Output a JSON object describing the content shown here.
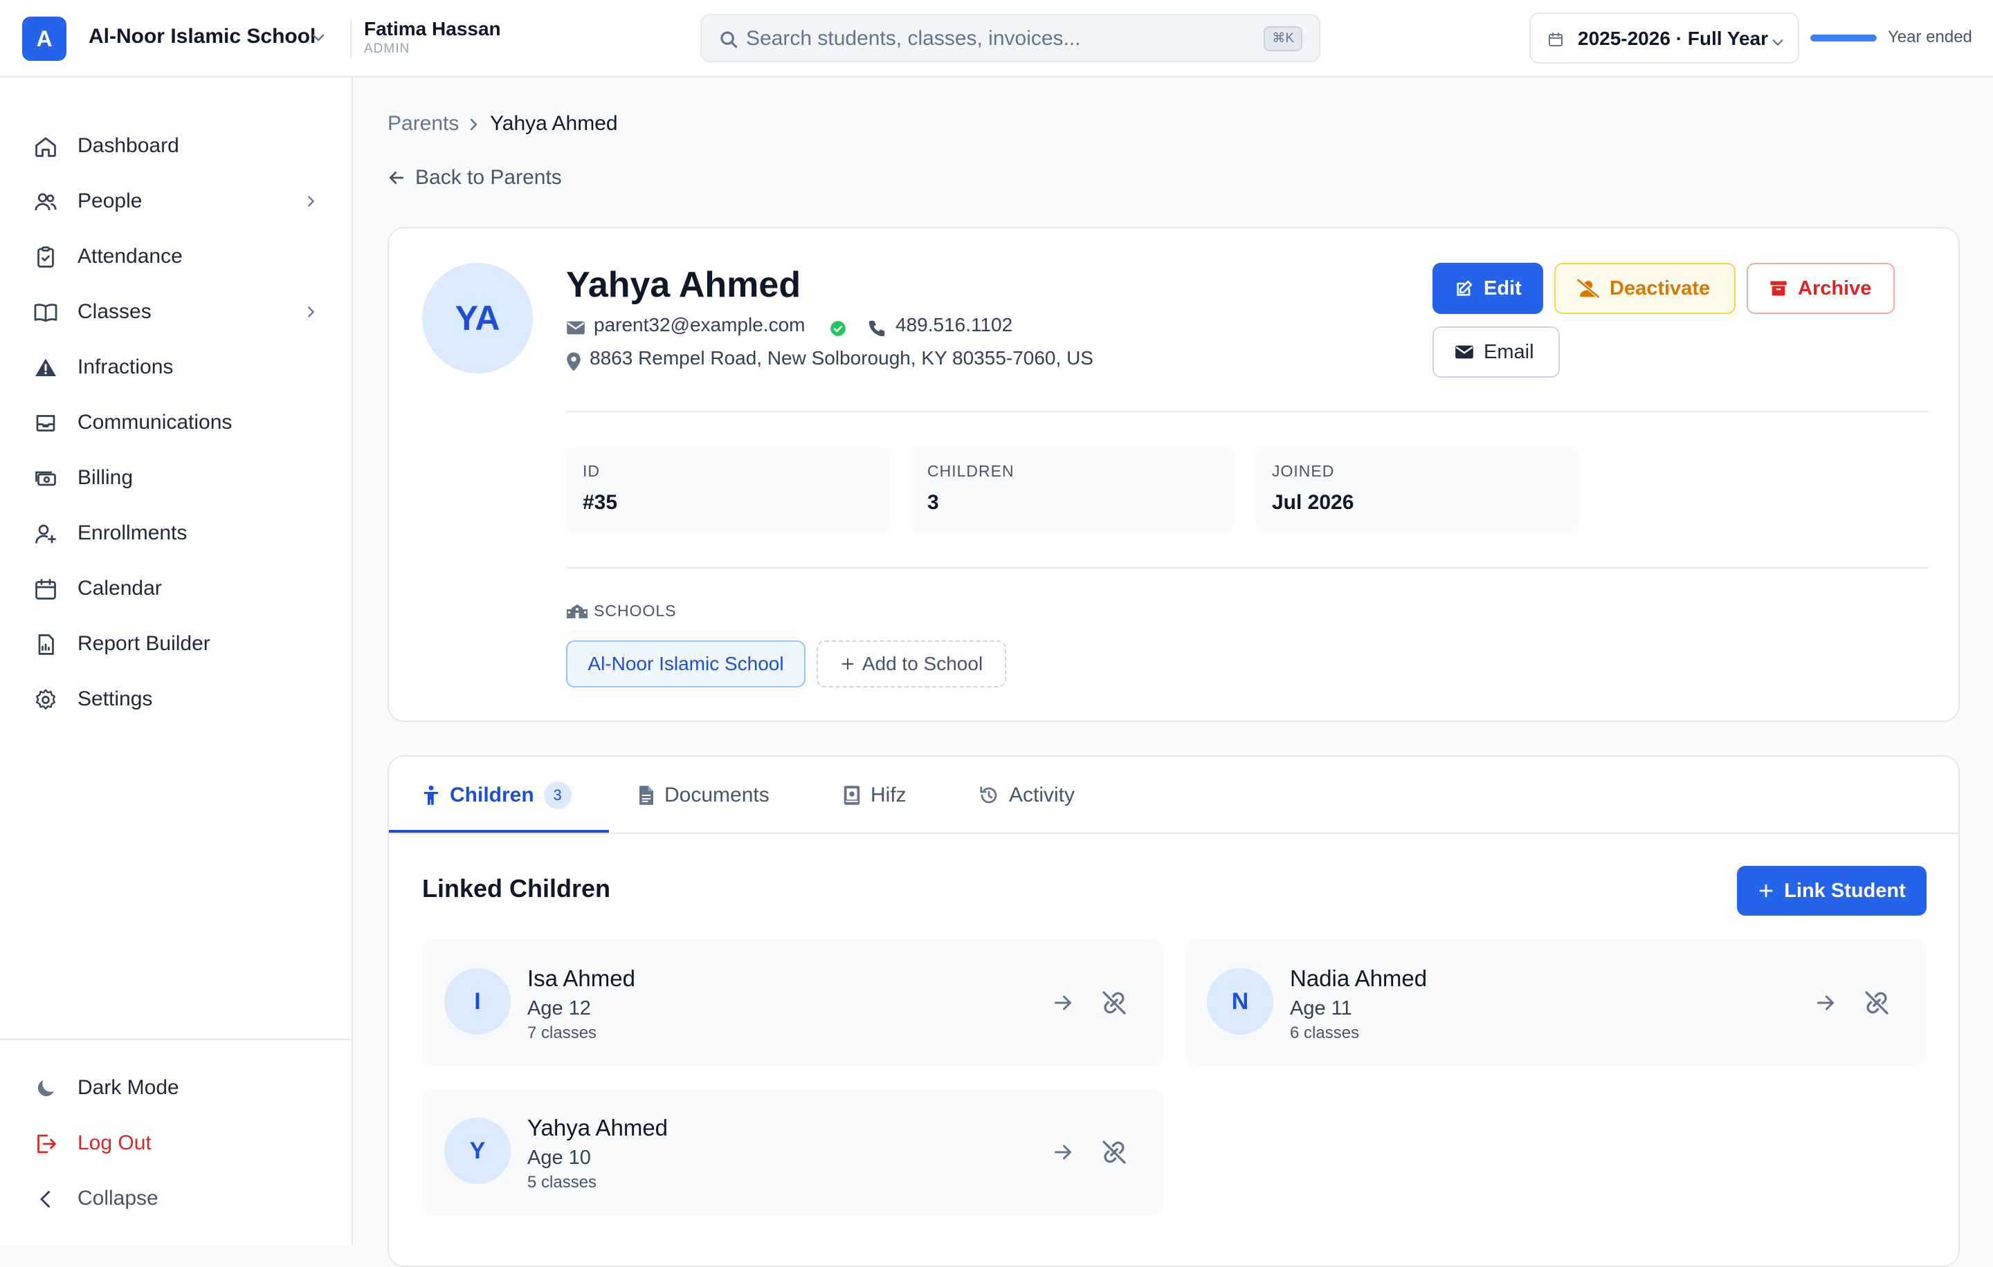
{
  "header": {
    "logo_letter": "A",
    "school_name": "Al-Noor Islamic School",
    "user_name": "Fatima Hassan",
    "user_role": "ADMIN",
    "search_placeholder": "Search students, classes, invoices...",
    "search_shortcut": "⌘K",
    "year_label": "2025-2026 · Full Year",
    "year_progress_percent": 100,
    "year_status": "Year ended"
  },
  "sidebar": {
    "items": [
      {
        "label": "Dashboard",
        "icon": "home-icon"
      },
      {
        "label": "People",
        "icon": "users-icon",
        "has_submenu": true
      },
      {
        "label": "Attendance",
        "icon": "clipboard-check-icon"
      },
      {
        "label": "Classes",
        "icon": "book-open-icon",
        "has_submenu": true
      },
      {
        "label": "Infractions",
        "icon": "warning-icon"
      },
      {
        "label": "Communications",
        "icon": "inbox-icon"
      },
      {
        "label": "Billing",
        "icon": "cash-icon"
      },
      {
        "label": "Enrollments",
        "icon": "user-plus-icon"
      },
      {
        "label": "Calendar",
        "icon": "calendar-icon"
      },
      {
        "label": "Report Builder",
        "icon": "report-icon"
      },
      {
        "label": "Settings",
        "icon": "gear-icon"
      }
    ],
    "footer": {
      "dark_mode": "Dark Mode",
      "logout": "Log Out",
      "collapse": "Collapse"
    }
  },
  "breadcrumb": {
    "parent": "Parents",
    "current": "Yahya Ahmed"
  },
  "back_link": "Back to Parents",
  "profile": {
    "initials": "YA",
    "name": "Yahya Ahmed",
    "email": "parent32@example.com",
    "phone": "489.516.1102",
    "address": "8863 Rempel Road, New Solborough, KY 80355-7060, US",
    "actions": {
      "edit": "Edit",
      "deactivate": "Deactivate",
      "archive": "Archive",
      "email": "Email"
    },
    "stats": [
      {
        "label": "ID",
        "value": "#35"
      },
      {
        "label": "CHILDREN",
        "value": "3"
      },
      {
        "label": "JOINED",
        "value": "Jul 2026"
      }
    ],
    "schools_label": "SCHOOLS",
    "schools": [
      "Al-Noor Islamic School"
    ],
    "add_school": "Add to School"
  },
  "tabs": {
    "items": [
      {
        "label": "Children",
        "badge": "3",
        "active": true
      },
      {
        "label": "Documents"
      },
      {
        "label": "Hifz"
      },
      {
        "label": "Activity"
      }
    ]
  },
  "children_section": {
    "title": "Linked Children",
    "link_button": "Link Student",
    "children": [
      {
        "initial": "I",
        "name": "Isa Ahmed",
        "age": "Age 12",
        "classes": "7 classes"
      },
      {
        "initial": "N",
        "name": "Nadia Ahmed",
        "age": "Age 11",
        "classes": "6 classes"
      },
      {
        "initial": "Y",
        "name": "Yahya Ahmed",
        "age": "Age 10",
        "classes": "5 classes"
      }
    ]
  },
  "colors": {
    "accent": "#2563eb",
    "warning": "#d97706",
    "danger": "#dc2626",
    "success": "#22c55e"
  }
}
